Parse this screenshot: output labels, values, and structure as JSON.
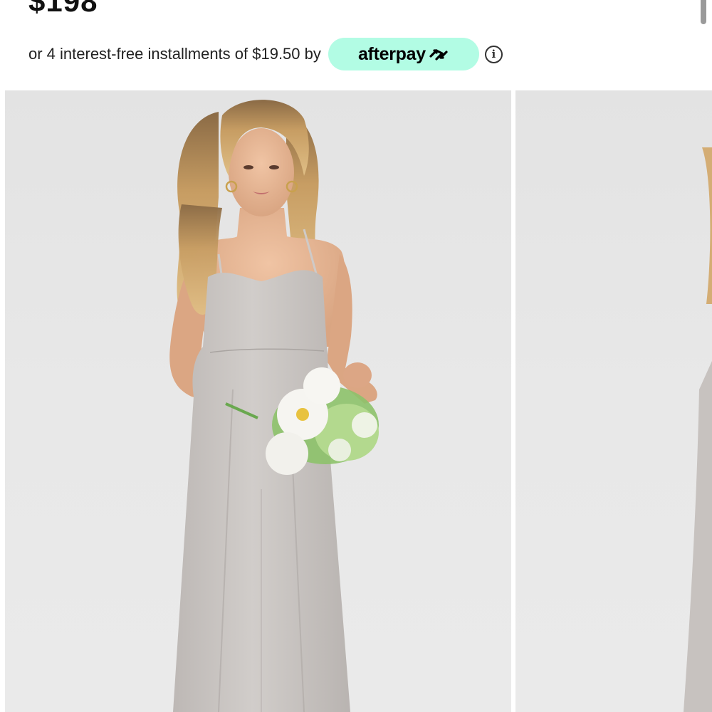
{
  "product": {
    "price": "$198"
  },
  "payment": {
    "installments_text": "or 4 interest-free installments of $19.50 by",
    "provider_label": "afterpay",
    "provider_icon": "afterpay-arrows-icon",
    "info_icon": "info-icon"
  },
  "gallery": {
    "images": [
      {
        "name": "model-front-view-photo",
        "subject": "model in dove grey maxi dress holding white bouquet"
      },
      {
        "name": "model-side-view-photo",
        "subject": "model in dove grey maxi dress, partial view"
      }
    ]
  },
  "colors": {
    "afterpay_mint": "#b2fce4",
    "dress_grey": "#c9c5c2",
    "background_grey": "#e6e6e6"
  }
}
